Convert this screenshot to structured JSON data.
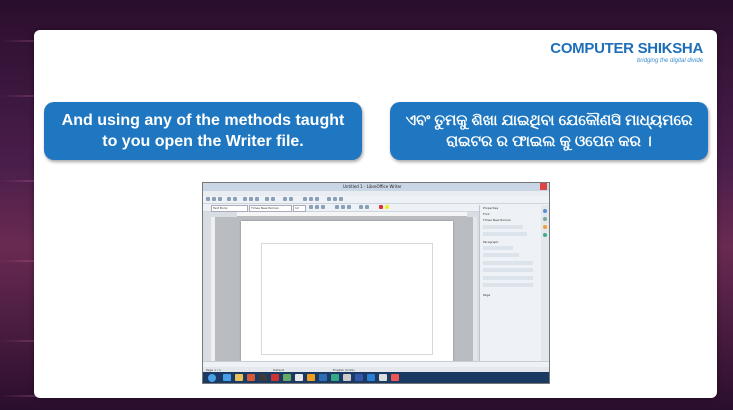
{
  "logo": {
    "main": "COMPUTER SHIKSHA",
    "tagline": "bridging the digital divide"
  },
  "slide": {
    "english_text": "And using any of the methods taught to you open the Writer file.",
    "odia_text": "ଏବଂ ତୁମକୁ ଶିଖା ଯାଇଥିବା ଯେକୌଣସି ମାଧ୍ୟମରେ ରାଇଟର ର ଫାଇଲ କୁ ଓପେନ କର ।"
  },
  "writer_window": {
    "title": "Untitled 1 - LibreOffice Writer",
    "menu": [
      "File",
      "Edit",
      "View",
      "Insert",
      "Format",
      "Table",
      "Tools",
      "Window",
      "Help"
    ],
    "style_box": "Text Body",
    "font_box": "Times New Roman",
    "size_box": "12",
    "sidebar": {
      "properties": "Properties",
      "character": "Font",
      "font": "Times New Roman",
      "paragraph": "Paragraph",
      "page": "Page"
    },
    "status": {
      "page": "Page 1 / 1",
      "style": "Default",
      "language": "English (India)"
    }
  }
}
